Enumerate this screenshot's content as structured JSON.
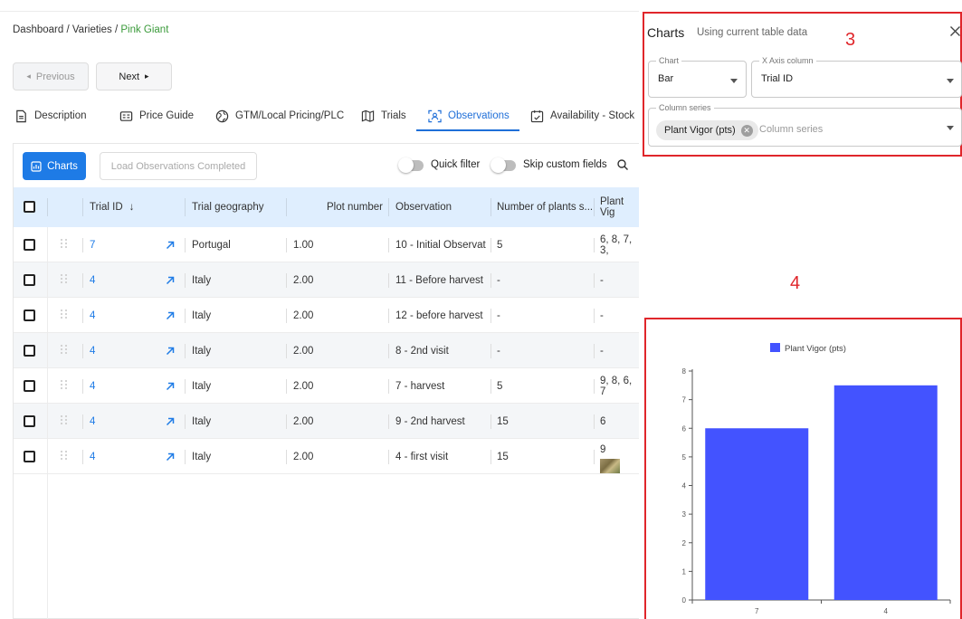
{
  "breadcrumb": {
    "items": [
      "Dashboard",
      "Varieties"
    ],
    "separator": " / ",
    "current": "Pink Giant"
  },
  "nav": {
    "previous_label": "Previous",
    "next_label": "Next"
  },
  "tabs": [
    {
      "label": "Description",
      "icon": "document-icon"
    },
    {
      "label": "Price Guide",
      "icon": "price-guide-icon"
    },
    {
      "label": "GTM/Local Pricing/PLC",
      "icon": "globe-icon"
    },
    {
      "label": "Trials",
      "icon": "map-icon"
    },
    {
      "label": "Observations",
      "icon": "observation-scan-icon",
      "active": true
    },
    {
      "label": "Availability - Stock",
      "icon": "calendar-check-icon"
    }
  ],
  "toolbar": {
    "charts_label": "Charts",
    "load_label": "Load Observations Completed",
    "quick_filter_label": "Quick filter",
    "skip_custom_label": "Skip custom fields"
  },
  "table": {
    "columns": [
      "Trial ID",
      "Trial geography",
      "Plot number",
      "Observation",
      "Number of plants s...",
      "Plant Vig"
    ],
    "rows": [
      {
        "trial_id": "7",
        "geography": "Portugal",
        "plot": "1.00",
        "observation": "10 - Initial Observat",
        "plants": "5",
        "vigor": "6, 8, 7, 3,"
      },
      {
        "trial_id": "4",
        "geography": "Italy",
        "plot": "2.00",
        "observation": "11 - Before harvest",
        "plants": "-",
        "vigor": "-"
      },
      {
        "trial_id": "4",
        "geography": "Italy",
        "plot": "2.00",
        "observation": "12 - before harvest",
        "plants": "-",
        "vigor": "-"
      },
      {
        "trial_id": "4",
        "geography": "Italy",
        "plot": "2.00",
        "observation": "8 - 2nd visit",
        "plants": "-",
        "vigor": "-"
      },
      {
        "trial_id": "4",
        "geography": "Italy",
        "plot": "2.00",
        "observation": "7 - harvest",
        "plants": "5",
        "vigor": "9, 8, 6, 7"
      },
      {
        "trial_id": "4",
        "geography": "Italy",
        "plot": "2.00",
        "observation": "9 - 2nd harvest",
        "plants": "15",
        "vigor": "6"
      },
      {
        "trial_id": "4",
        "geography": "Italy",
        "plot": "2.00",
        "observation": "4 - first visit",
        "plants": "15",
        "vigor": "9"
      }
    ]
  },
  "panel": {
    "title": "Charts",
    "subtitle": "Using current table data",
    "chart_field": {
      "label": "Chart",
      "value": "Bar"
    },
    "xaxis_field": {
      "label": "X Axis column",
      "value": "Trial ID"
    },
    "series_field": {
      "label": "Column series",
      "chip": "Plant Vigor (pts)",
      "placeholder": "Column series"
    }
  },
  "annotations": {
    "box3": "3",
    "box4": "4"
  },
  "colors": {
    "accent": "#1e7be6",
    "bar": "#4353ff",
    "annotation": "#e0262b",
    "breadcrumb_current": "#3a9a3a"
  },
  "chart_data": {
    "type": "bar",
    "categories": [
      "7",
      "4"
    ],
    "series": [
      {
        "name": "Plant Vigor (pts)",
        "values": [
          6,
          7.5
        ]
      }
    ],
    "ylim": [
      0,
      8
    ],
    "yticks": [
      0,
      1,
      2,
      3,
      4,
      5,
      6,
      7,
      8
    ],
    "legend": "top"
  }
}
